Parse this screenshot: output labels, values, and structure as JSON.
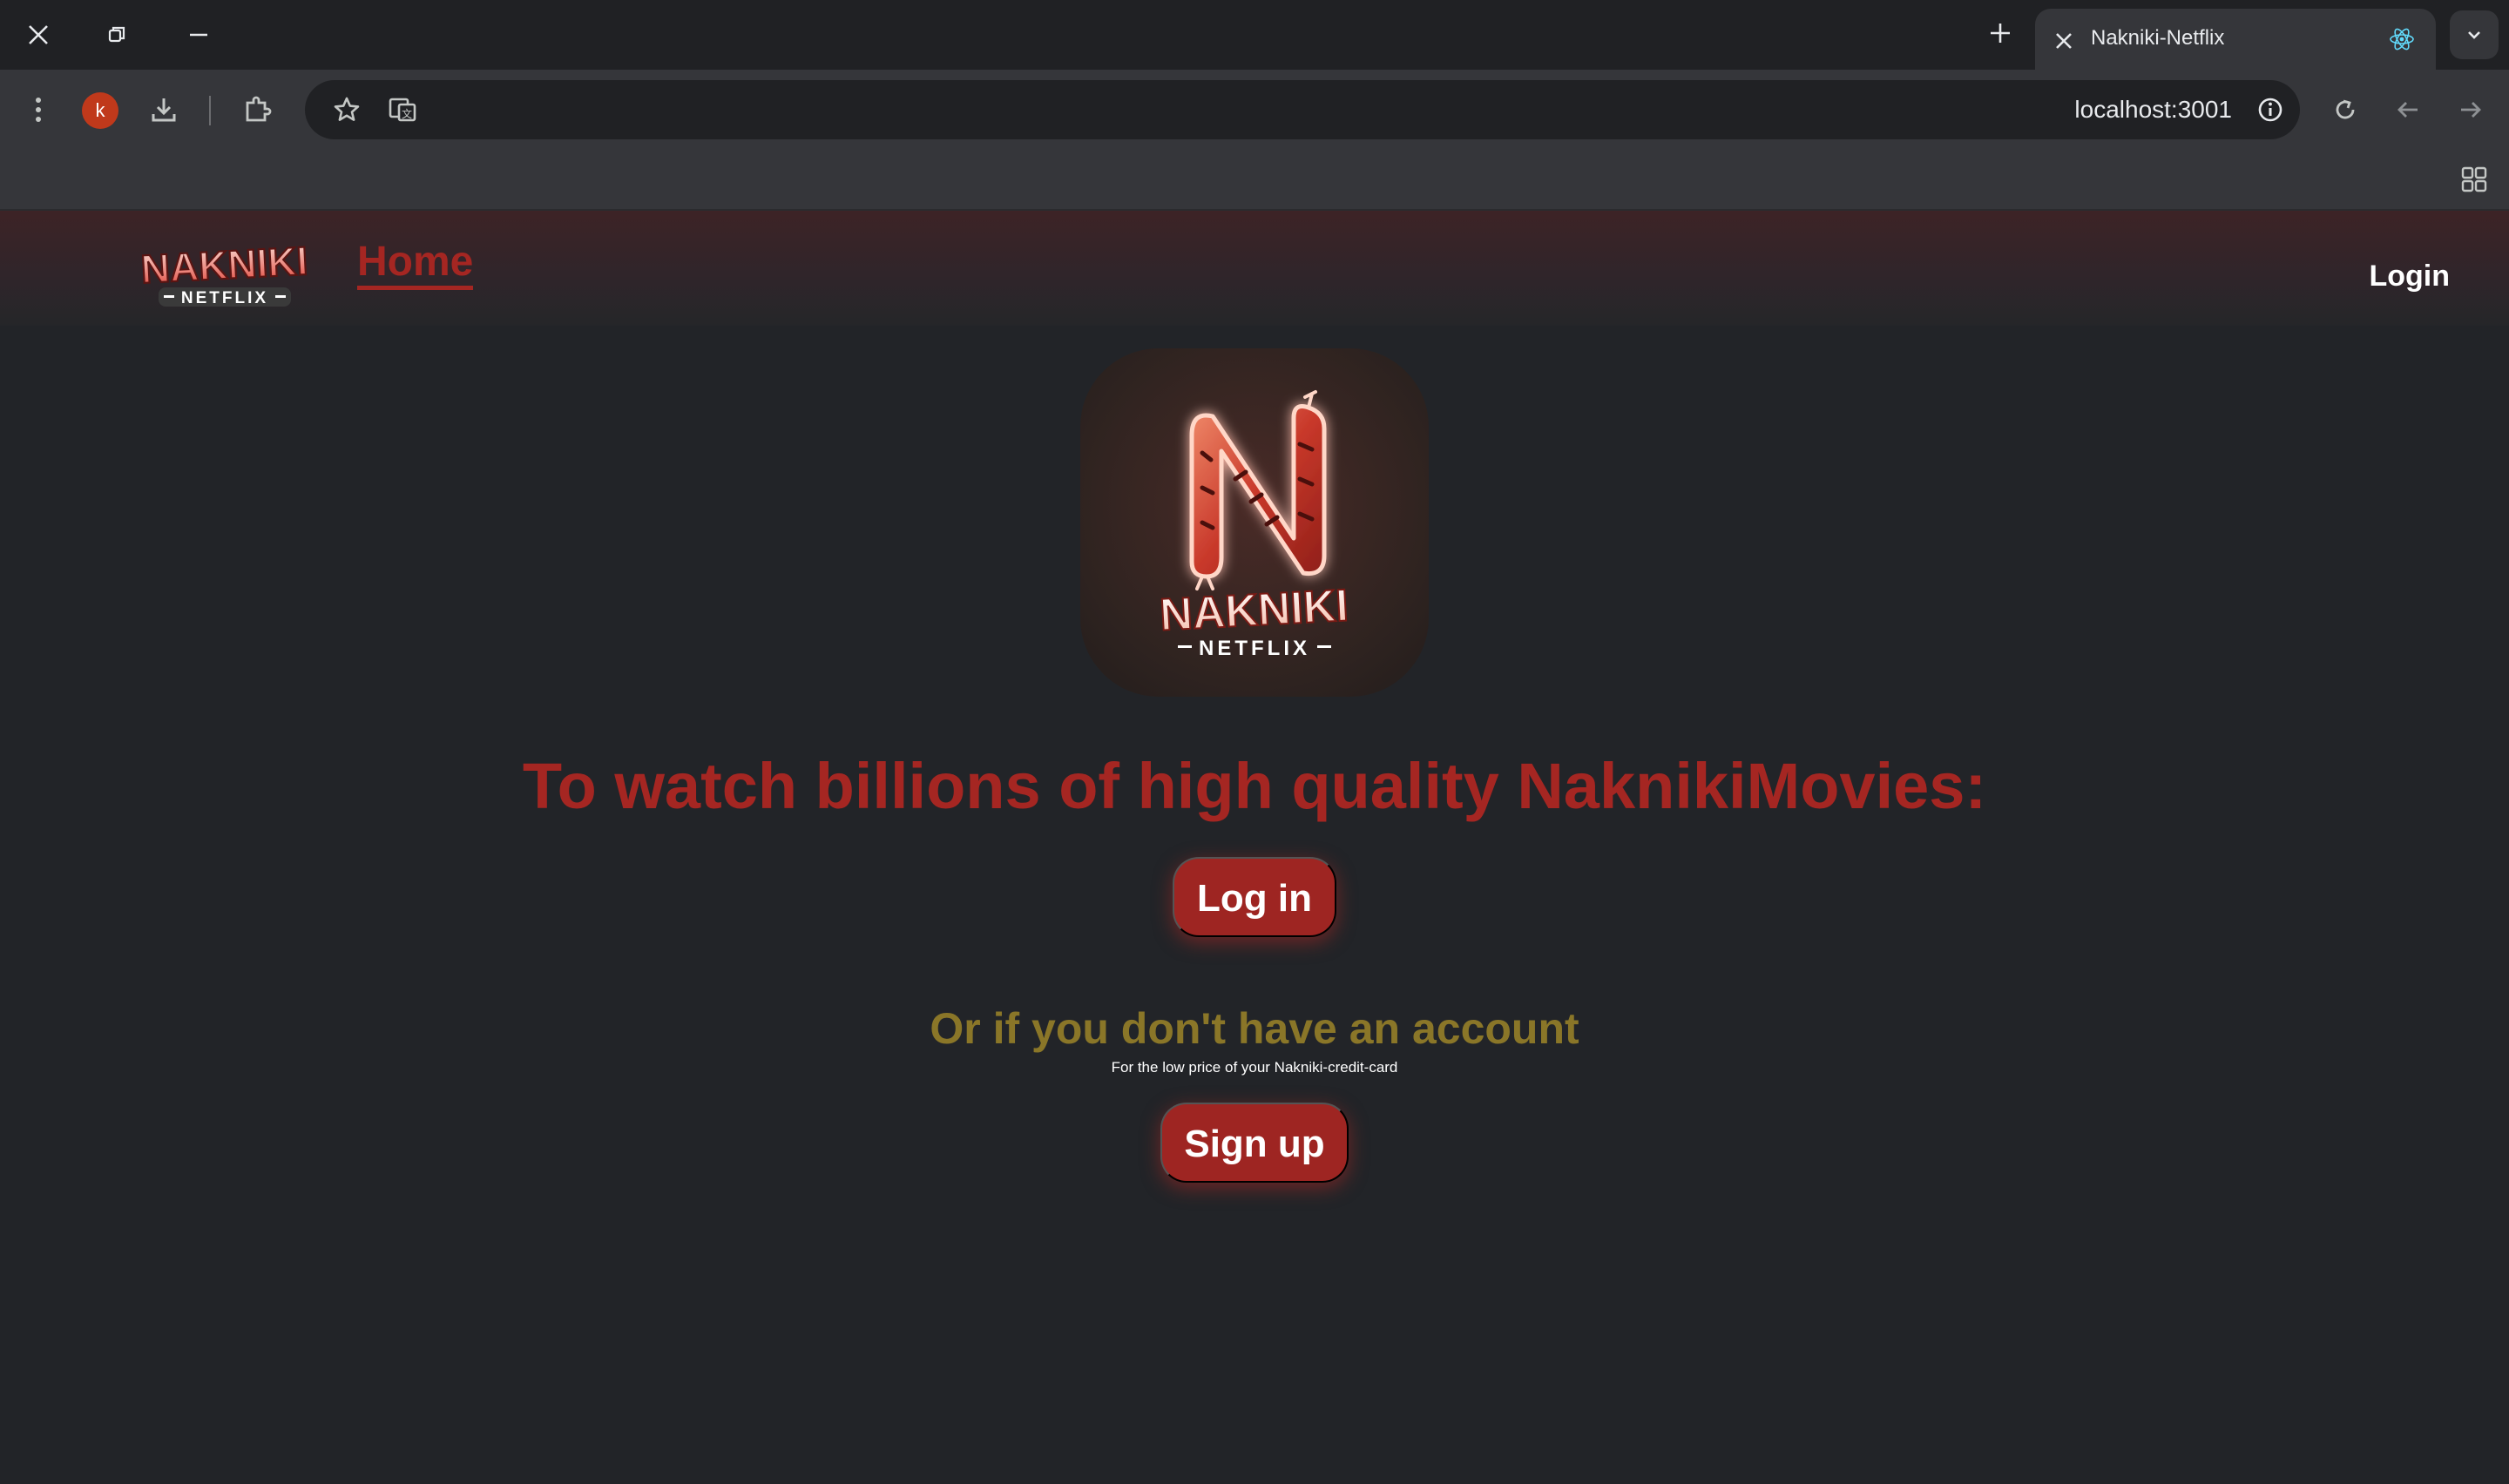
{
  "browser": {
    "tab_title": "Nakniki-Netflix",
    "url": "localhost:3001",
    "profile_initial": "k"
  },
  "site": {
    "brand_main": "NAKNIKI",
    "brand_sub": "NETFLIX",
    "nav_home": "Home",
    "nav_login": "Login"
  },
  "main": {
    "headline": "To watch billions of high quality NaknikiMovies:",
    "login_button": "Log in",
    "subheadline": "Or if you don't have an account",
    "tagline": "For the low price of your Nakniki-credit-card",
    "signup_button": "Sign up"
  },
  "colors": {
    "accent_red": "#a52622",
    "gold": "#8a7628",
    "background": "#222428"
  }
}
